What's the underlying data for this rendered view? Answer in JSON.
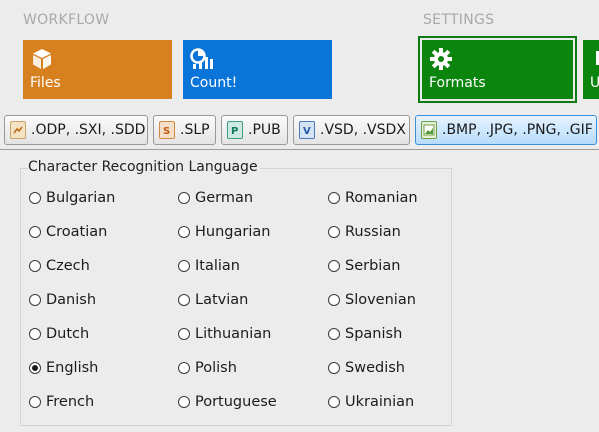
{
  "sections": {
    "workflow": "WORKFLOW",
    "settings": "SETTINGS"
  },
  "tiles": {
    "files": {
      "label": "Files",
      "color": "#d6801f",
      "icon": "cube-icon"
    },
    "count": {
      "label": "Count!",
      "color": "#0b74d9",
      "icon": "chart-icon"
    },
    "formats": {
      "label": "Formats",
      "color": "#0b850d",
      "icon": "gear-icon",
      "selected": true
    },
    "partial": {
      "label": "U",
      "color": "#0b850d",
      "icon": "partial-icon"
    }
  },
  "tabs": [
    {
      "label": ".ODP, .SXI, .SDD",
      "icon": "presentation-file-icon"
    },
    {
      "label": ".SLP",
      "icon": "slp-file-icon"
    },
    {
      "label": ".PUB",
      "icon": "publisher-file-icon"
    },
    {
      "label": ".VSD, .VSDX",
      "icon": "visio-file-icon"
    },
    {
      "label": ".BMP, .JPG, .PNG, .GIF",
      "icon": "image-file-icon",
      "active": true
    }
  ],
  "ocr": {
    "title": "Character Recognition Language",
    "selected": "English",
    "columns": [
      [
        "Bulgarian",
        "Croatian",
        "Czech",
        "Danish",
        "Dutch",
        "English",
        "French"
      ],
      [
        "German",
        "Hungarian",
        "Italian",
        "Latvian",
        "Lithuanian",
        "Polish",
        "Portuguese"
      ],
      [
        "Romanian",
        "Russian",
        "Serbian",
        "Slovenian",
        "Spanish",
        "Swedish",
        "Ukrainian"
      ]
    ]
  },
  "colors": {
    "accent_orange": "#d6801f",
    "accent_blue": "#0b74d9",
    "accent_green": "#0b850d",
    "tab_active": "#b6dcfb"
  }
}
